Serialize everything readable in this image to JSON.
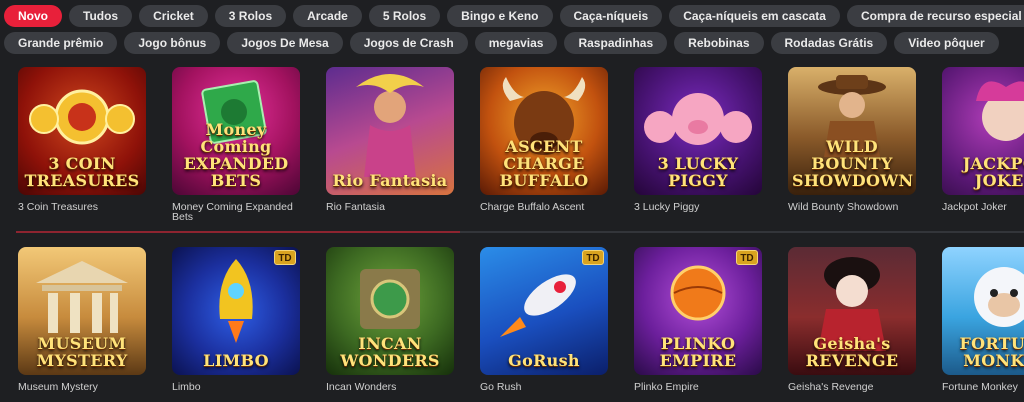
{
  "filters": {
    "row1": [
      {
        "label": "Novo",
        "active": true
      },
      {
        "label": "Tudos"
      },
      {
        "label": "Cricket"
      },
      {
        "label": "3 Rolos"
      },
      {
        "label": "Arcade"
      },
      {
        "label": "5 Rolos"
      },
      {
        "label": "Bingo e Keno"
      },
      {
        "label": "Caça-níqueis"
      },
      {
        "label": "Caça-níqueis em cascata"
      },
      {
        "label": "Compra de recurso especial"
      }
    ],
    "row2": [
      {
        "label": "Grande prêmio"
      },
      {
        "label": "Jogo bônus"
      },
      {
        "label": "Jogos De Mesa"
      },
      {
        "label": "Jogos de Crash"
      },
      {
        "label": "megavias"
      },
      {
        "label": "Raspadinhas"
      },
      {
        "label": "Rebobinas"
      },
      {
        "label": "Rodadas Grátis"
      },
      {
        "label": "Video pôquer"
      }
    ]
  },
  "games": {
    "row1": [
      {
        "title": "3 Coin Treasures",
        "logo": "3 COIN TREASURES",
        "icon": "coin-icon"
      },
      {
        "title": "Money Coming Expanded Bets",
        "logo": "Money Coming EXPANDED BETS",
        "icon": "money-icon"
      },
      {
        "title": "Rio Fantasia",
        "logo": "Rio Fantasia",
        "icon": "feather-icon"
      },
      {
        "title": "Charge Buffalo Ascent",
        "logo": "ASCENT CHARGE BUFFALO",
        "icon": "buffalo-icon"
      },
      {
        "title": "3 Lucky Piggy",
        "logo": "3 LUCKY PIGGY",
        "icon": "pig-icon"
      },
      {
        "title": "Wild Bounty Showdown",
        "logo": "WILD BOUNTY SHOWDOWN",
        "icon": "cowgirl-icon"
      },
      {
        "title": "Jackpot Joker",
        "logo": "JACKPOT JOKER",
        "icon": "joker-icon"
      }
    ],
    "row2": [
      {
        "title": "Museum Mystery",
        "logo": "MUSEUM MYSTERY",
        "icon": "museum-icon"
      },
      {
        "title": "Limbo",
        "logo": "LIMBO",
        "badge": "TD",
        "icon": "rocket-icon"
      },
      {
        "title": "Incan Wonders",
        "logo": "INCAN WONDERS",
        "icon": "temple-icon"
      },
      {
        "title": "Go Rush",
        "logo": "GoRush",
        "badge": "TD",
        "icon": "rocket-icon"
      },
      {
        "title": "Plinko Empire",
        "logo": "PLINKO EMPIRE",
        "badge": "TD",
        "icon": "ball-icon"
      },
      {
        "title": "Geisha's Revenge",
        "logo": "Geisha's REVENGE",
        "icon": "geisha-icon"
      },
      {
        "title": "Fortune Monkey",
        "logo": "FORTUNE MONKEY",
        "icon": "monkey-icon"
      }
    ]
  },
  "progress": 0.44,
  "colors": {
    "accent": "#e8203a",
    "chip_bg": "#3b3d42",
    "page_bg": "#1e1f22"
  }
}
